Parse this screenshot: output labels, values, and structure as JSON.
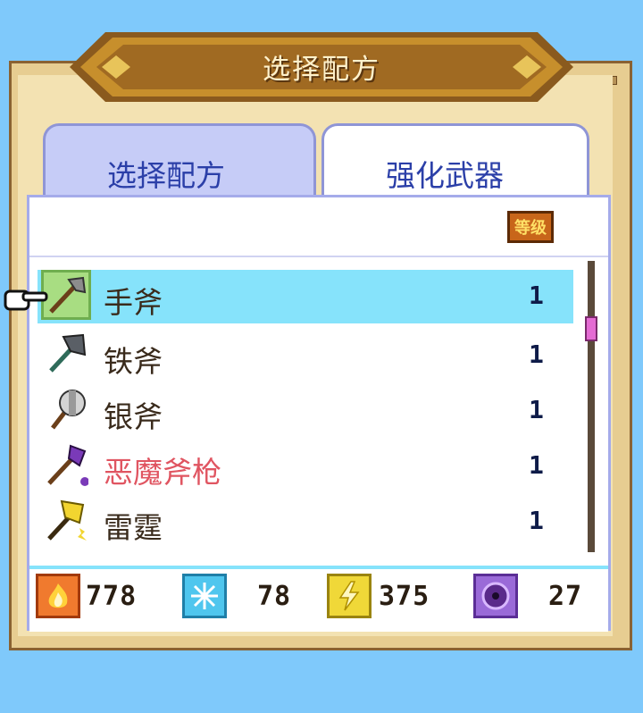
{
  "window": {
    "title": "选择配方"
  },
  "tabs": [
    {
      "label": "选择配方",
      "active": false
    },
    {
      "label": "强化武器",
      "active": true
    }
  ],
  "header": {
    "level_badge": "等级"
  },
  "items": [
    {
      "name": "手斧",
      "level": "1",
      "icon": "hand-axe-icon",
      "selected": true,
      "rare": false
    },
    {
      "name": "铁斧",
      "level": "1",
      "icon": "iron-axe-icon",
      "selected": false,
      "rare": false
    },
    {
      "name": "银斧",
      "level": "1",
      "icon": "silver-axe-icon",
      "selected": false,
      "rare": false
    },
    {
      "name": "恶魔斧枪",
      "level": "1",
      "icon": "demon-halberd-icon",
      "selected": false,
      "rare": true
    },
    {
      "name": "雷霆",
      "level": "1",
      "icon": "thunder-axe-icon",
      "selected": false,
      "rare": false
    }
  ],
  "resources": [
    {
      "icon": "fire-icon",
      "value": "778",
      "color": "#f07a2e"
    },
    {
      "icon": "ice-icon",
      "value": "78",
      "color": "#4fc6ee"
    },
    {
      "icon": "lightning-icon",
      "value": "375",
      "color": "#f0d838"
    },
    {
      "icon": "dark-vortex-icon",
      "value": "27",
      "color": "#9a6ad8"
    }
  ],
  "colors": {
    "background": "#7fc9fb",
    "frame": "#e7cd91",
    "selected_row": "#86e3fb",
    "rare_text": "#e05561"
  }
}
